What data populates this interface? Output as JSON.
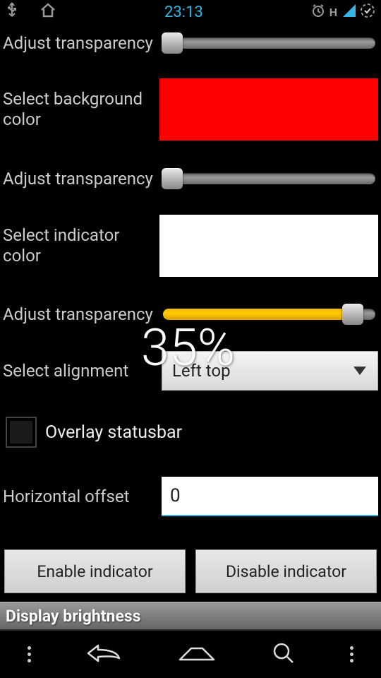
{
  "status": {
    "time": "23:13",
    "network_label": "H"
  },
  "settings": {
    "r1": {
      "label": "Adjust transparency",
      "slider": {
        "value": 4,
        "max": 100
      }
    },
    "r2": {
      "label": "Select background color",
      "color": "#ff0000"
    },
    "r3": {
      "label": "Adjust transparency",
      "slider": {
        "value": 4,
        "max": 100
      }
    },
    "r4": {
      "label": "Select indicator color",
      "color": "#ffffff"
    },
    "r5": {
      "label": "Adjust transparency",
      "slider": {
        "value": 85,
        "max": 100
      }
    },
    "r6": {
      "label": "Select alignment",
      "selected": "Left top"
    },
    "r7": {
      "label": "Overlay statusbar",
      "checked": false
    },
    "r8": {
      "label": "Horizontal offset",
      "value": "0"
    }
  },
  "buttons": {
    "enable": "Enable indicator",
    "disable": "Disable indicator"
  },
  "section": {
    "brightness": "Display brightness"
  },
  "overlay": {
    "percent": "35%"
  }
}
